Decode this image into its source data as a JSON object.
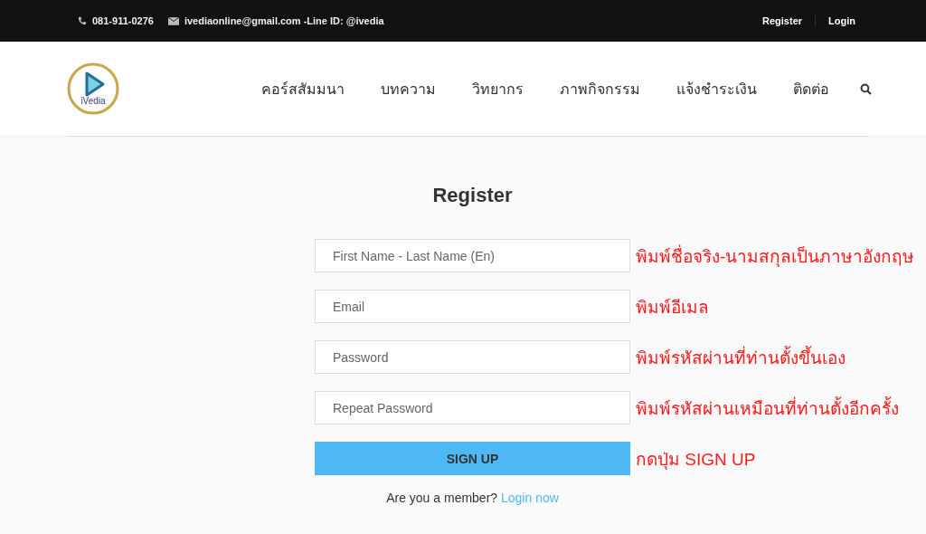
{
  "top_bar": {
    "phone": "081-911-0276",
    "contact": "ivediaonline@gmail.com -Line ID: @ivedia",
    "links": [
      {
        "label": "Register"
      },
      {
        "label": "Login"
      }
    ]
  },
  "header": {
    "logo_text": "iVedia",
    "nav": [
      {
        "label": "คอร์สสัมมนา"
      },
      {
        "label": "บทความ"
      },
      {
        "label": "วิทยากร"
      },
      {
        "label": "ภาพกิจกรรม"
      },
      {
        "label": "แจ้งชำระเงิน"
      },
      {
        "label": "ติดต่อ"
      }
    ]
  },
  "form": {
    "title": "Register",
    "fields": [
      {
        "placeholder": "First Name - Last Name (En)",
        "note": "พิมพ์ชื่อจริง-นามสกุลเป็นภาษาอังกฤษ"
      },
      {
        "placeholder": "Email",
        "note": "พิมพ์อีเมล"
      },
      {
        "placeholder": "Password",
        "note": "พิมพ์รหัสผ่านที่ท่านตั้งขึ้นเอง"
      },
      {
        "placeholder": "Repeat Password",
        "note": "พิมพ์รหัสผ่านเหมือนที่ท่านตั้งอีกครั้ง"
      }
    ],
    "button": {
      "label": "SIGN UP",
      "note": "กดปุ่ม SIGN UP"
    },
    "member_text": "Are you a member?",
    "login_link": "Login now"
  }
}
